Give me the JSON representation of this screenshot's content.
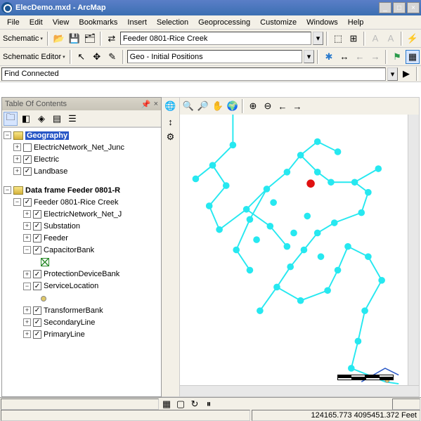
{
  "title": "ElecDemo.mxd - ArcMap",
  "menu": [
    "File",
    "Edit",
    "View",
    "Bookmarks",
    "Insert",
    "Selection",
    "Geoprocessing",
    "Customize",
    "Windows",
    "Help"
  ],
  "toolbar1": {
    "schematic_label": "Schematic",
    "feeder_dd": "Feeder 0801-Rice Creek"
  },
  "toolbar2": {
    "editor_label": "Schematic Editor",
    "layout_dd": "Geo - Initial Positions"
  },
  "search": "Find Connected",
  "toc": {
    "title": "Table Of Contents",
    "root1": {
      "label": "Geography",
      "children": [
        {
          "label": "ElectricNetwork_Net_Junc",
          "checked": false
        },
        {
          "label": "Electric",
          "checked": true
        },
        {
          "label": "Landbase",
          "checked": true
        }
      ]
    },
    "root2": {
      "label": "Data frame Feeder 0801-R",
      "child": {
        "label": "Feeder 0801-Rice Creek",
        "checked": true,
        "children": [
          {
            "label": "ElectricNetwork_Net_J",
            "checked": true,
            "exp": "+"
          },
          {
            "label": "Substation",
            "checked": true,
            "exp": "+"
          },
          {
            "label": "Feeder",
            "checked": true,
            "exp": "+"
          },
          {
            "label": "CapacitorBank",
            "checked": true,
            "exp": "-",
            "sym": "sq"
          },
          {
            "label": "ProtectionDeviceBank",
            "checked": true,
            "exp": "+"
          },
          {
            "label": "ServiceLocation",
            "checked": true,
            "exp": "-",
            "sym": "circ"
          },
          {
            "label": "TransformerBank",
            "checked": true,
            "exp": "+"
          },
          {
            "label": "SecondaryLine",
            "checked": true,
            "exp": "+"
          },
          {
            "label": "PrimaryLine",
            "checked": true,
            "exp": "+"
          }
        ]
      }
    }
  },
  "status": {
    "coords": "124165.773  4095451.372 Feet"
  }
}
